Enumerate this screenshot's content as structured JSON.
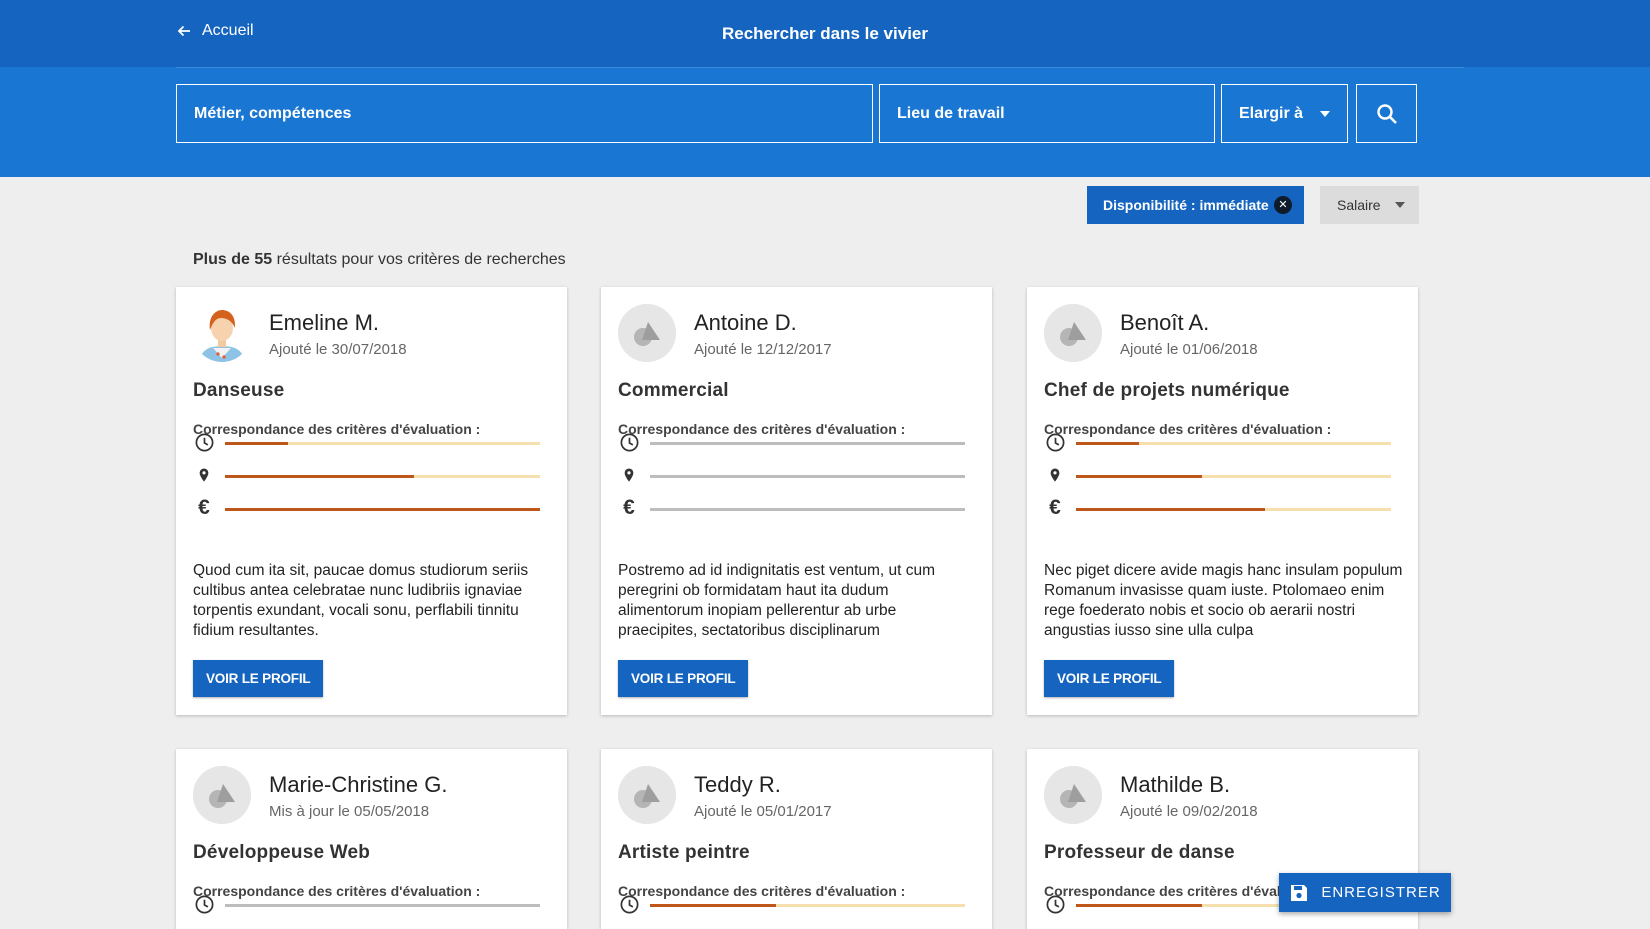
{
  "header": {
    "back_label": "Accueil",
    "title": "Rechercher dans le vivier"
  },
  "search": {
    "job_placeholder": "Métier, compétences",
    "location_placeholder": "Lieu de travail",
    "widen_label": "Elargir à"
  },
  "filters": {
    "availability_chip": "Disponibilité : immédiate",
    "salary_label": "Salaire"
  },
  "results": {
    "prefix": "Plus de 55",
    "suffix": " résultats pour vos critères de recherches"
  },
  "criteria_label": "Correspondance des critères d'évaluation :",
  "profile_button": "VOIR LE PROFIL",
  "save_button": "ENREGISTRER",
  "colors": {
    "primary": "#1565c0",
    "band": "#1976d2",
    "match_fill": "#c0571a",
    "match_track": "#f5dfae"
  },
  "cards": [
    {
      "name": "Emeline M.",
      "date": "Ajouté le 30/07/2018",
      "job": "Danseuse",
      "avatar": "woman-avatar",
      "scores": [
        0.2,
        0.6,
        1.0
      ],
      "desc": "Quod cum ita sit, paucae domus studiorum seriis cultibus antea celebratae nunc ludibriis ignaviae torpentis exundant, vocali sonu, perflabili tinnitu fidium resultantes."
    },
    {
      "name": "Antoine D.",
      "date": "Ajouté le 12/12/2017",
      "job": "Commercial",
      "avatar": "placeholder-avatar",
      "scores": [
        0,
        0,
        0
      ],
      "desc": "Postremo ad id indignitatis est ventum, ut cum peregrini ob formidatam haut ita dudum alimentorum inopiam pellerentur ab urbe praecipites, sectatoribus disciplinarum"
    },
    {
      "name": "Benoît A.",
      "date": "Ajouté le 01/06/2018",
      "job": "Chef de projets numérique",
      "avatar": "placeholder-avatar",
      "scores": [
        0.2,
        0.4,
        0.6
      ],
      "desc": "Nec piget dicere avide magis hanc insulam populum Romanum invasisse quam iuste. Ptolomaeo enim rege foederato nobis et socio ob aerarii nostri angustias iusso sine ulla culpa"
    },
    {
      "name": "Marie-Christine G.",
      "date": "Mis à jour le 05/05/2018",
      "job": "Développeuse Web",
      "avatar": "placeholder-avatar",
      "scores": [
        0
      ]
    },
    {
      "name": "Teddy R.",
      "date": "Ajouté le 05/01/2017",
      "job": "Artiste peintre",
      "avatar": "placeholder-avatar",
      "scores": [
        0.4
      ]
    },
    {
      "name": "Mathilde B.",
      "date": "Ajouté le 09/02/2018",
      "job": "Professeur de danse",
      "avatar": "placeholder-avatar",
      "scores": [
        0.4
      ]
    }
  ]
}
